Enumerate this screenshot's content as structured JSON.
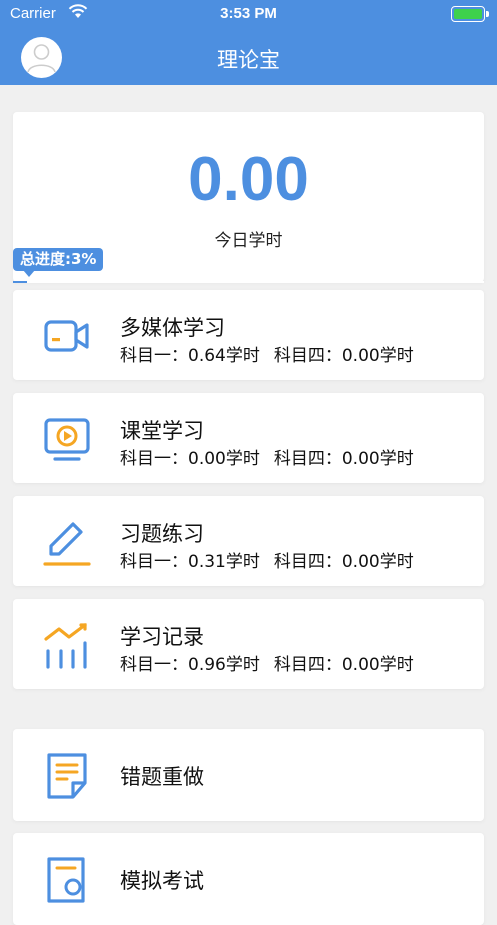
{
  "status_bar": {
    "carrier": "Carrier",
    "time": "3:53 PM"
  },
  "header": {
    "title": "理论宝"
  },
  "today": {
    "value": "0.00",
    "label": "今日学时"
  },
  "progress": {
    "label": "总进度:3%",
    "percent": 3
  },
  "study_rows": [
    {
      "title": "多媒体学习",
      "subject1": "科目一：0.64学时",
      "subject4": "科目四：0.00学时",
      "icon": "video-camera-icon"
    },
    {
      "title": "课堂学习",
      "subject1": "科目一：0.00学时",
      "subject4": "科目四：0.00学时",
      "icon": "tv-play-icon"
    },
    {
      "title": "习题练习",
      "subject1": "科目一：0.31学时",
      "subject4": "科目四：0.00学时",
      "icon": "pencil-icon"
    },
    {
      "title": "学习记录",
      "subject1": "科目一：0.96学时",
      "subject4": "科目四：0.00学时",
      "icon": "chart-trend-icon"
    }
  ],
  "extra_rows": [
    {
      "title": "错题重做",
      "icon": "document-edit-icon"
    },
    {
      "title": "模拟考试",
      "icon": "document-search-icon"
    }
  ],
  "colors": {
    "brand_blue": "#4d8fe0",
    "accent_orange": "#f5a623",
    "battery_green": "#3ed14c"
  }
}
